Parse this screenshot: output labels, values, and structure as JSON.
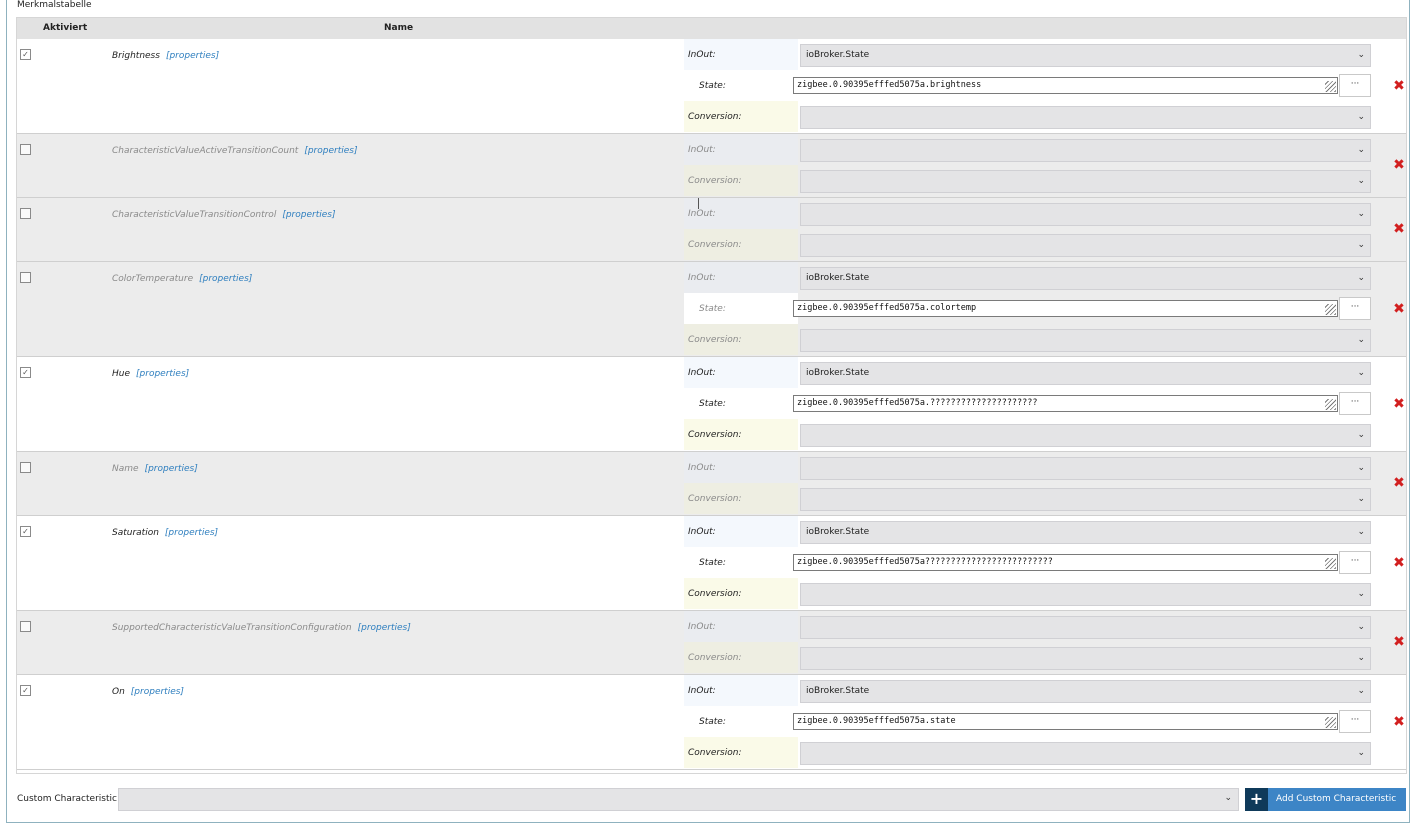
{
  "section_title": "Merkmalstabelle",
  "header": {
    "col_enabled": "Aktiviert",
    "col_name": "Name"
  },
  "labels": {
    "inout": "InOut:",
    "state": "State:",
    "conversion": "Conversion:",
    "properties": "[properties]",
    "dots": "···",
    "checkmark": "✓",
    "delete_icon": "✖"
  },
  "rows": [
    {
      "name": "Brightness",
      "enabled": true,
      "inout_value": "ioBroker.State",
      "state_value": "zigbee.0.90395efffed5075a.brightness",
      "conversion_value": ""
    },
    {
      "name": "CharacteristicValueActiveTransitionCount",
      "enabled": false,
      "inout_value": "",
      "conversion_value": ""
    },
    {
      "name": "CharacteristicValueTransitionControl",
      "enabled": false,
      "inout_value": "",
      "conversion_value": ""
    },
    {
      "name": "ColorTemperature",
      "enabled": false,
      "inout_value": "ioBroker.State",
      "state_value": "zigbee.0.90395efffed5075a.colortemp",
      "conversion_value": ""
    },
    {
      "name": "Hue",
      "enabled": true,
      "inout_value": "ioBroker.State",
      "state_value": "zigbee.0.90395efffed5075a.?????????????????????",
      "conversion_value": ""
    },
    {
      "name": "Name",
      "enabled": false,
      "inout_value": "",
      "conversion_value": ""
    },
    {
      "name": "Saturation",
      "enabled": true,
      "inout_value": "ioBroker.State",
      "state_value": "zigbee.0.90395efffed5075a?????????????????????????",
      "conversion_value": ""
    },
    {
      "name": "SupportedCharacteristicValueTransitionConfiguration",
      "enabled": false,
      "inout_value": "",
      "conversion_value": ""
    },
    {
      "name": "On",
      "enabled": true,
      "inout_value": "ioBroker.State",
      "state_value": "zigbee.0.90395efffed5075a.state",
      "conversion_value": ""
    }
  ],
  "footer": {
    "custom_label": "Custom Characteristic",
    "custom_select_value": "",
    "add_button_label": "Add Custom Characteristic",
    "add_icon": "+"
  },
  "colors": {
    "accent": "#3d85c6",
    "accent_dark": "#0f3a5a",
    "delete": "#d21f1f",
    "link": "#2f7fbf"
  }
}
